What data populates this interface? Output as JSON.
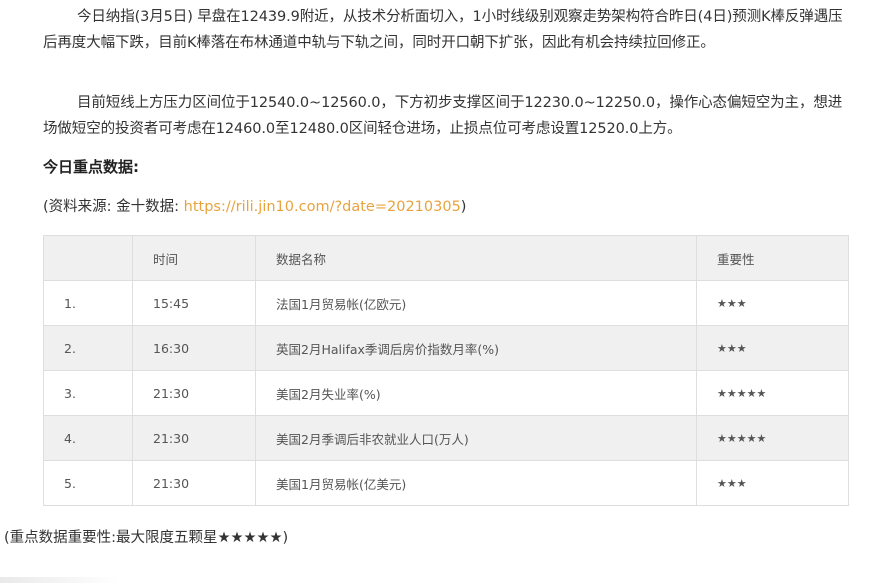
{
  "article": {
    "paragraph_1": "今日纳指(3月5日) 早盘在12439.9附近，从技术分析面切入，1小时线级别观察走势架构符合昨日(4日)预测K棒反弹遇压后再度大幅下跌，目前K棒落在布林通道中轨与下轨之间，同时开口朝下扩张，因此有机会持续拉回修正。",
    "paragraph_2": "目前短线上方压力区间位于12540.0~12560.0，下方初步支撑区间于12230.0~12250.0，操作心态偏短空为主，想进场做短空的投资者可考虑在12460.0至12480.0区间轻仓进场，止损点位可考虑设置12520.0上方。",
    "section_title": "今日重点数据:",
    "source_prefix": "(资料来源: 金十数据: ",
    "source_link": "https://rili.jin10.com/?date=20210305",
    "source_suffix": ")",
    "link_color": "#e8a33d"
  },
  "table": {
    "headers": [
      "",
      "时间",
      "数据名称",
      "重要性"
    ],
    "rows": [
      {
        "index": "1.",
        "time": "15:45",
        "name": "法国1月贸易帐(亿欧元)",
        "importance": "★★★"
      },
      {
        "index": "2.",
        "time": "16:30",
        "name": "英国2月Halifax季调后房价指数月率(%)",
        "importance": "★★★"
      },
      {
        "index": "3.",
        "time": "21:30",
        "name": "美国2月失业率(%)",
        "importance": "★★★★★"
      },
      {
        "index": "4.",
        "time": "21:30",
        "name": "美国2月季调后非农就业人口(万人)",
        "importance": "★★★★★"
      },
      {
        "index": "5.",
        "time": "21:30",
        "name": "美国1月贸易帐(亿美元)",
        "importance": "★★★"
      }
    ]
  },
  "footnote": "(重点数据重要性:最大限度五颗星★★★★★)"
}
